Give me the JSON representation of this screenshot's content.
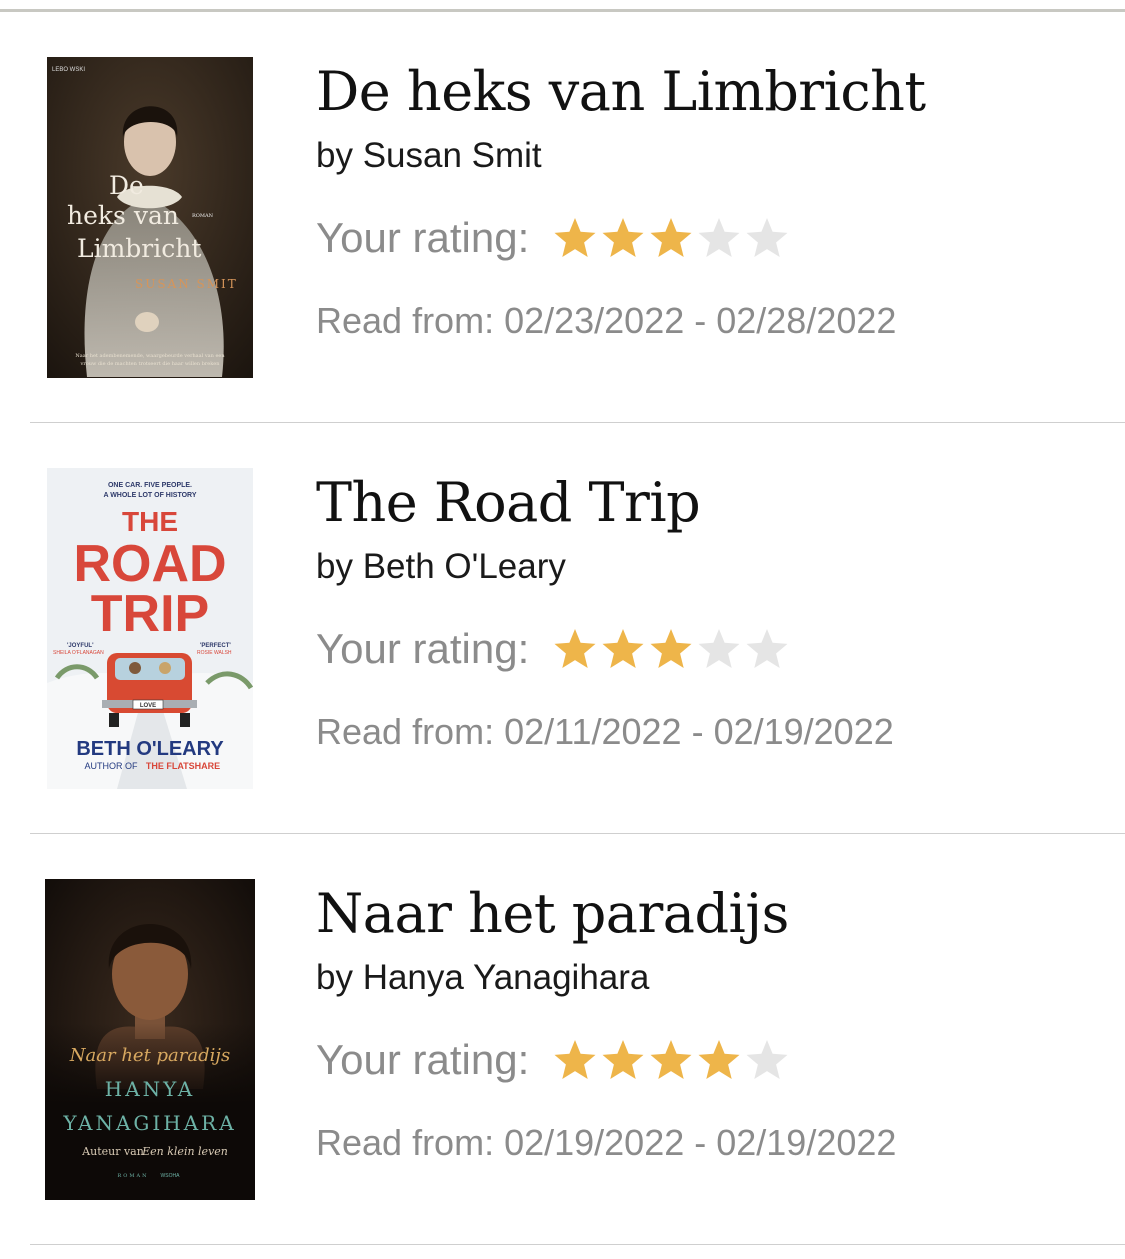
{
  "colors": {
    "star_filled": "#eeb54a",
    "star_empty": "#e5e5e5",
    "divider": "#cfcfcf",
    "muted_text": "#8b8b8b"
  },
  "books": [
    {
      "title": "De heks van Limbricht",
      "author_line": "by Susan Smit",
      "rating_label": "Your rating:",
      "rating": 3,
      "rating_max": 5,
      "read_dates": "Read from: 02/23/2022 - 02/28/2022",
      "cover": {
        "publisher": "LEBO WSKI",
        "title_lines": [
          "De",
          "heks van",
          "Limbricht"
        ],
        "genre": "ROMAN",
        "author": "SUSAN SMIT",
        "blurb_lines": [
          "Naar het adembenemende, waargebeurde verhaal van een",
          "vrouw die de machten trotseert die haar willen breken"
        ]
      }
    },
    {
      "title": "The Road Trip",
      "author_line": "by Beth O'Leary",
      "rating_label": "Your rating:",
      "rating": 3,
      "rating_max": 5,
      "read_dates": "Read from: 02/11/2022 - 02/19/2022",
      "cover": {
        "tagline_lines": [
          "ONE CAR. FIVE PEOPLE.",
          "A WHOLE LOT OF HISTORY"
        ],
        "title_lines": [
          "THE",
          "ROAD",
          "TRIP"
        ],
        "quote_left": "'JOYFUL'",
        "quote_left_source": "SHEILA O'FLANAGAN",
        "quote_right": "'PERFECT'",
        "quote_right_source": "ROSIE WALSH",
        "plate": "LOVE",
        "author": "BETH O'LEARY",
        "author_of": "AUTHOR OF",
        "other_title": "THE FLATSHARE"
      }
    },
    {
      "title": "Naar het paradijs",
      "author_line": "by Hanya Yanagihara",
      "rating_label": "Your rating:",
      "rating": 4,
      "rating_max": 5,
      "read_dates": "Read from: 02/19/2022 - 02/19/2022",
      "cover": {
        "title": "Naar het paradijs",
        "author_first": "HANYA",
        "author_last": "YANAGIHARA",
        "byline_prefix": "Auteur van",
        "byline_title": "Een klein leven",
        "genre": "ROMAN",
        "publisher": "WSOHA"
      }
    }
  ]
}
